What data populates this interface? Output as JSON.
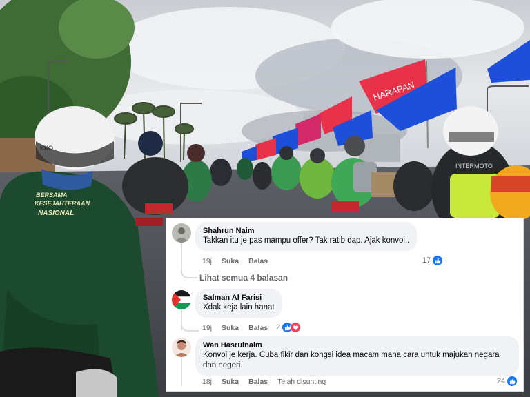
{
  "comments": [
    {
      "author": "Shahrun Naim",
      "text": "Takkan itu je pas mampu offer? Tak ratib dap. Ajak konvoi..",
      "time": "19j",
      "like_action": "Suka",
      "reply_action": "Balas",
      "reaction_count": "17",
      "reactions": [
        "like-icon"
      ]
    },
    {
      "author": "Salman Al Farisi",
      "text": "Xdak keja lain hanat",
      "time": "19j",
      "like_action": "Suka",
      "reply_action": "Balas",
      "reaction_count": "2",
      "reactions": [
        "like-icon",
        "heart-icon"
      ]
    },
    {
      "author": "Wan Hasrulnaim",
      "text": "Konvoi je kerja. Cuba fikir dan kongsi idea macam mana cara untuk majukan negara dan negeri.",
      "time": "18j",
      "like_action": "Suka",
      "reply_action": "Balas",
      "edited_label": "Telah disunting",
      "reaction_count": "24",
      "reactions": [
        "like-icon"
      ]
    }
  ],
  "view_replies": "Lihat semua 4 balasan",
  "photo": {
    "flag_text": "HARAPAN",
    "shirt_text_line1": "BERSAMA",
    "shirt_text_line2": "KESEJAHTERAAN",
    "shirt_text_line3": "NASIONAL",
    "helmet_brand": "KKO",
    "vest_brand": "INTERMOTO"
  },
  "colors": {
    "facebook_blue": "#1877f2",
    "love_red": "#f33e58",
    "bubble_bg": "#f0f2f5",
    "meta_gray": "#65676b",
    "flag_red": "#e8324a",
    "flag_blue": "#1e4fd8"
  }
}
